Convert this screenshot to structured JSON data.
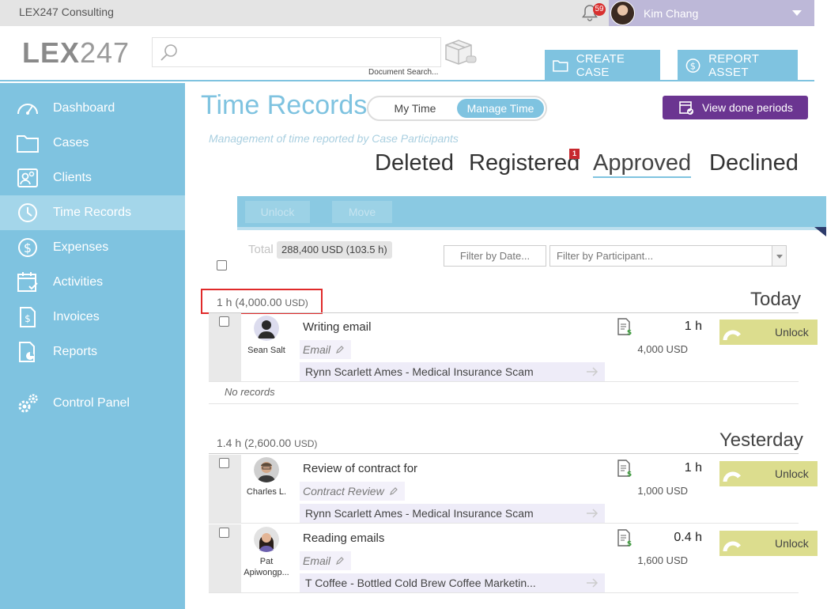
{
  "topbar": {
    "company": "LEX247 Consulting",
    "notifications": "59",
    "user_name": "Kim Chang"
  },
  "header": {
    "logo_bold": "LEX",
    "logo_thin": "247",
    "search_placeholder": "",
    "search_label": "Document Search...",
    "create_case": "CREATE CASE",
    "report_asset": "REPORT ASSET"
  },
  "sidebar": {
    "items": [
      {
        "label": "Dashboard",
        "icon": "speedometer-icon"
      },
      {
        "label": "Cases",
        "icon": "folder-icon"
      },
      {
        "label": "Clients",
        "icon": "clients-icon"
      },
      {
        "label": "Time Records",
        "icon": "clock-icon"
      },
      {
        "label": "Expenses",
        "icon": "dollar-icon"
      },
      {
        "label": "Activities",
        "icon": "calendar-icon"
      },
      {
        "label": "Invoices",
        "icon": "invoice-icon"
      },
      {
        "label": "Reports",
        "icon": "report-icon"
      },
      {
        "label": "Control Panel",
        "icon": "gears-icon"
      }
    ],
    "active": "Time Records"
  },
  "main": {
    "title": "Time Records",
    "toggle": {
      "my_time": "My Time",
      "manage_time": "Manage Time"
    },
    "view_done": "View done periods",
    "subtitle": "Management of time reported by Case Participants",
    "tabs": [
      {
        "label": "Deleted"
      },
      {
        "label": "Registered",
        "badge": "1"
      },
      {
        "label": "Approved"
      },
      {
        "label": "Declined"
      }
    ],
    "active_tab": "Approved",
    "actions": {
      "unlock": "Unlock",
      "move": "Move"
    },
    "total_label": "Total",
    "total_value": "288,400 USD (103.5 h)",
    "filter_date": "Filter by Date...",
    "filter_participant": "Filter by Participant..."
  },
  "groups": [
    {
      "hours": "1 h",
      "amount": "(4,000.00",
      "currency": "USD)",
      "day": "Today",
      "records": [
        {
          "person": "Sean Salt",
          "description": "Writing email",
          "category": "Email",
          "case": "Rynn Scarlett Ames - Medical Insurance Scam",
          "hours": "1 h",
          "amount": "4,000 USD",
          "action": "Unlock"
        }
      ],
      "empty_text": "No records"
    },
    {
      "hours": "1.4 h",
      "amount": "(2,600.00",
      "currency": "USD)",
      "day": "Yesterday",
      "records": [
        {
          "person": "Charles L.",
          "description": "Review of contract for",
          "category": "Contract Review",
          "case": "Rynn Scarlett Ames - Medical Insurance Scam",
          "hours": "1 h",
          "amount": "1,000 USD",
          "action": "Unlock"
        },
        {
          "person_line1": "Pat",
          "person_line2": "Apiwongp...",
          "description": "Reading emails",
          "category": "Email",
          "case": "T Coffee - Bottled Cold Brew Coffee Marketin...",
          "hours": "0.4 h",
          "amount": "1,600 USD",
          "action": "Unlock"
        }
      ]
    }
  ],
  "colors": {
    "accent": "#7fc3e0",
    "purple": "#6b3591",
    "unlock": "#dcdd8e",
    "highlight": "#e02a2a"
  }
}
